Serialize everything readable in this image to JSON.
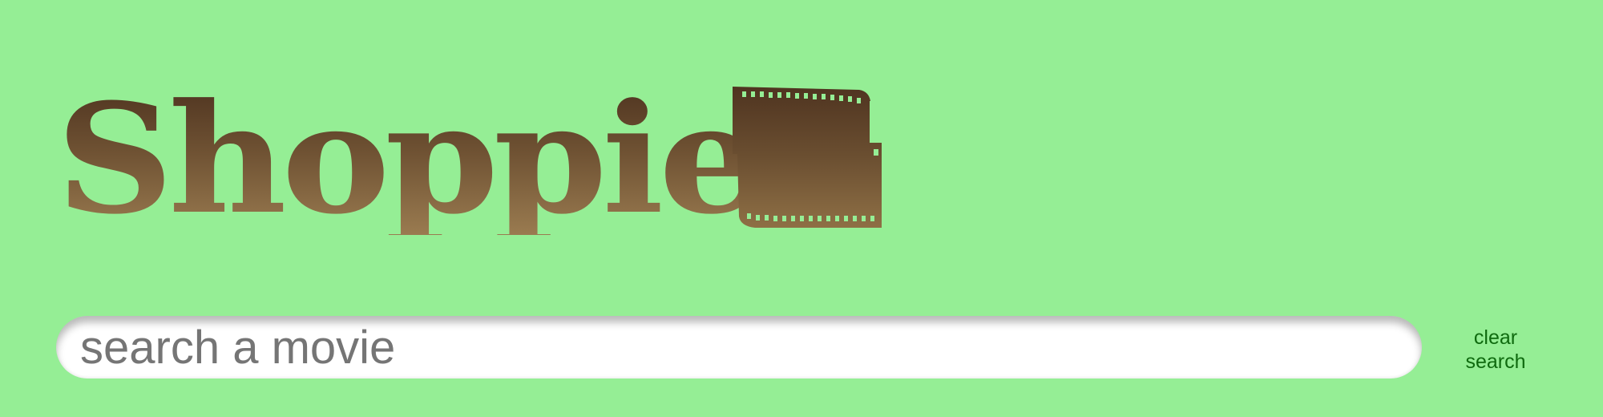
{
  "colors": {
    "background": "#95ee95",
    "logo_dark": "#4f3420",
    "logo_light": "#9a7b50",
    "search_bg": "#ffffff",
    "search_text": "#757575",
    "clear_button_text": "#0f6a0f"
  },
  "header": {
    "logo_text": "Shoppies",
    "logo_icon": "film-strip-icon"
  },
  "search": {
    "placeholder": "search a movie",
    "value": ""
  },
  "clear_button": {
    "label": "clear search"
  }
}
